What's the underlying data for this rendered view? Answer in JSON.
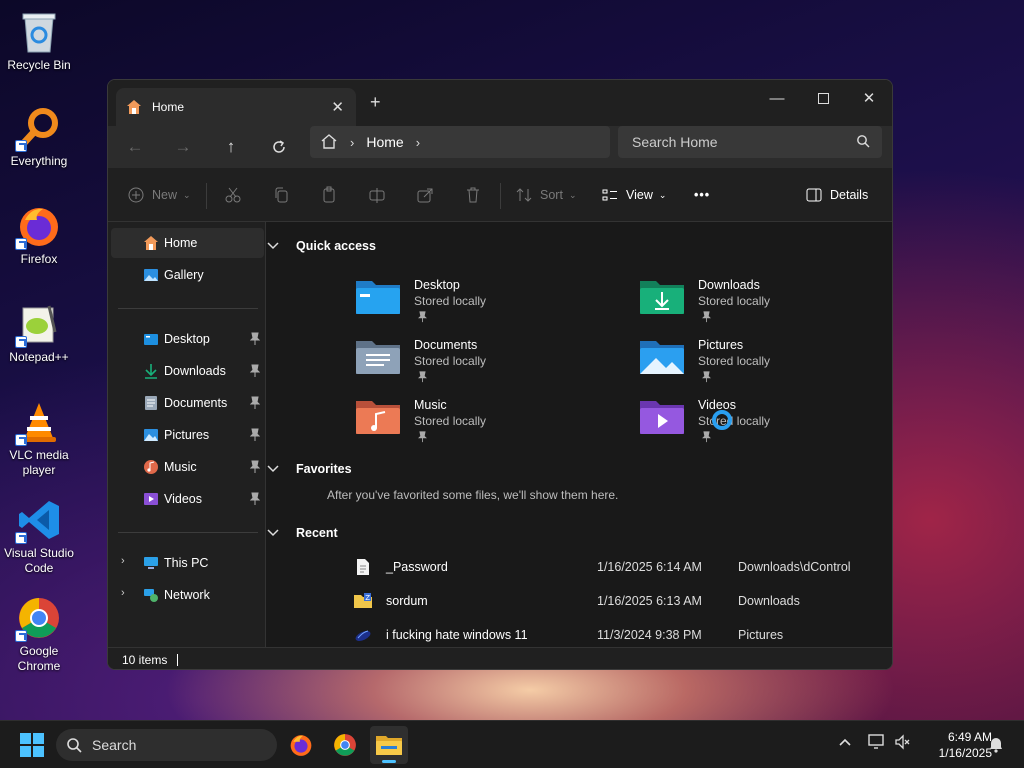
{
  "desktop": {
    "icons": [
      {
        "label": "Recycle Bin",
        "icon": "recycle-bin-icon"
      },
      {
        "label": "Everything",
        "icon": "everything-search-icon"
      },
      {
        "label": "Firefox",
        "icon": "firefox-icon"
      },
      {
        "label": "Notepad++",
        "icon": "notepad-plus-plus-icon"
      },
      {
        "label": "VLC media player",
        "icon": "vlc-icon"
      },
      {
        "label": "Visual Studio Code",
        "icon": "vscode-icon"
      },
      {
        "label": "Google Chrome",
        "icon": "chrome-icon"
      }
    ]
  },
  "window": {
    "tab_title": "Home",
    "address": {
      "crumb": "Home"
    },
    "search_placeholder": "Search Home",
    "toolbar": {
      "new_label": "New",
      "sort_label": "Sort",
      "view_label": "View",
      "more_label": "•••",
      "details_label": "Details"
    },
    "sidebar": {
      "top": [
        {
          "label": "Home",
          "icon": "home-icon",
          "selected": true
        },
        {
          "label": "Gallery",
          "icon": "gallery-icon"
        }
      ],
      "pinned": [
        {
          "label": "Desktop",
          "icon": "desktop-folder-icon"
        },
        {
          "label": "Downloads",
          "icon": "downloads-icon"
        },
        {
          "label": "Documents",
          "icon": "documents-icon"
        },
        {
          "label": "Pictures",
          "icon": "pictures-icon"
        },
        {
          "label": "Music",
          "icon": "music-icon"
        },
        {
          "label": "Videos",
          "icon": "videos-icon"
        }
      ],
      "drives": [
        {
          "label": "This PC",
          "icon": "this-pc-icon"
        },
        {
          "label": "Network",
          "icon": "network-icon"
        }
      ]
    },
    "sections": {
      "quick_access": "Quick access",
      "favorites": "Favorites",
      "favorites_empty": "After you've favorited some files, we'll show them here.",
      "recent": "Recent"
    },
    "quick_access": [
      {
        "name": "Desktop",
        "sub": "Stored locally",
        "color": "#1d8fe0"
      },
      {
        "name": "Downloads",
        "sub": "Stored locally",
        "color": "#18a06e"
      },
      {
        "name": "Documents",
        "sub": "Stored locally",
        "color": "#7a8ea6"
      },
      {
        "name": "Pictures",
        "sub": "Stored locally",
        "color": "#2b8fe0"
      },
      {
        "name": "Music",
        "sub": "Stored locally",
        "color": "#e0694a"
      },
      {
        "name": "Videos",
        "sub": "Stored locally",
        "color": "#8a4fd6"
      }
    ],
    "recent": [
      {
        "name": "_Password",
        "date": "1/16/2025 6:14 AM",
        "location": "Downloads\\dControl",
        "icon": "text-file-icon"
      },
      {
        "name": "sordum",
        "date": "1/16/2025 6:13 AM",
        "location": "Downloads",
        "icon": "zip-folder-icon"
      },
      {
        "name": "i fucking hate windows 11",
        "date": "11/3/2024 9:38 PM",
        "location": "Pictures",
        "icon": "image-file-icon"
      }
    ],
    "status": "10 items"
  },
  "taskbar": {
    "search_placeholder": "Search",
    "time": "6:49 AM",
    "date": "1/16/2025"
  }
}
